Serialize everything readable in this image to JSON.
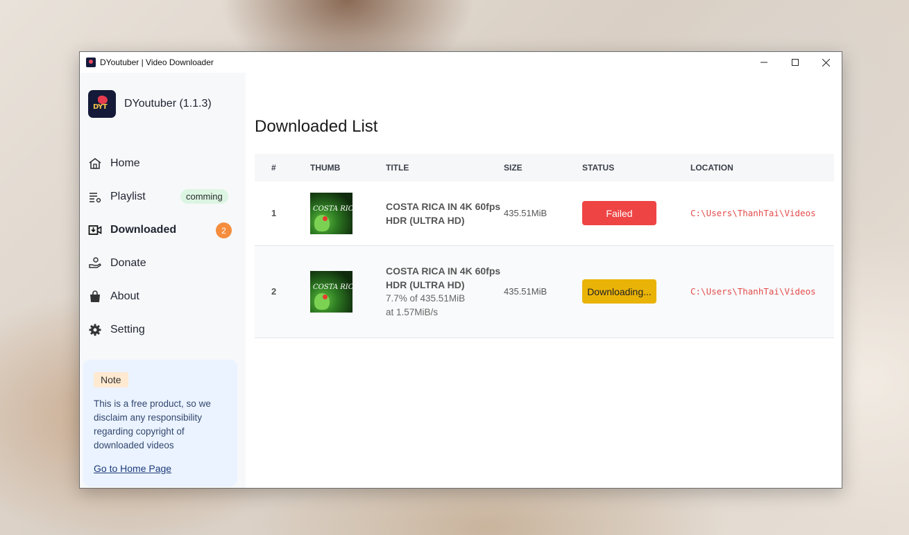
{
  "window": {
    "title": "DYoutuber | Video Downloader",
    "controls": {
      "minimize": "—",
      "maximize": "☐",
      "close": "✕"
    }
  },
  "sidebar": {
    "brand": {
      "logo_text": "DYT",
      "name": "DYoutuber (1.1.3)"
    },
    "items": [
      {
        "label": "Home",
        "icon": "home-icon"
      },
      {
        "label": "Playlist",
        "icon": "playlist-icon",
        "badge": "comming"
      },
      {
        "label": "Downloaded",
        "icon": "download-icon",
        "count": "2",
        "active": true
      },
      {
        "label": "Donate",
        "icon": "donate-icon"
      },
      {
        "label": "About",
        "icon": "bag-icon"
      },
      {
        "label": "Setting",
        "icon": "gear-icon"
      }
    ],
    "note": {
      "tag": "Note",
      "body": "This is a free product, so we disclaim any responsibility regarding copyright of downloaded videos",
      "link": "Go to Home Page"
    }
  },
  "main": {
    "title": "Downloaded List",
    "table": {
      "headers": [
        "#",
        "THUMB",
        "TITLE",
        "SIZE",
        "STATUS",
        "LOCATION"
      ],
      "rows": [
        {
          "num": "1",
          "thumb_text": "COSTA RICA",
          "title": "COSTA RICA IN 4K 60fps HDR (ULTRA HD)",
          "progress_line1": "",
          "progress_line2": "",
          "size": "435.51MiB",
          "status": "Failed",
          "location": "C:\\Users\\ThanhTai\\Videos"
        },
        {
          "num": "2",
          "thumb_text": "COSTA RICA",
          "title": "COSTA RICA IN 4K 60fps HDR (ULTRA HD)",
          "progress_line1": "7.7% of 435.51MiB",
          "progress_line2": "at 1.57MiB/s",
          "size": "435.51MiB",
          "status": "Downloading...",
          "location": "C:\\Users\\ThanhTai\\Videos"
        }
      ]
    },
    "colors": {
      "failed": "#ef4444",
      "downloading": "#eab308",
      "location": "#e44a4a",
      "count_badge": "#f58d3d"
    }
  }
}
